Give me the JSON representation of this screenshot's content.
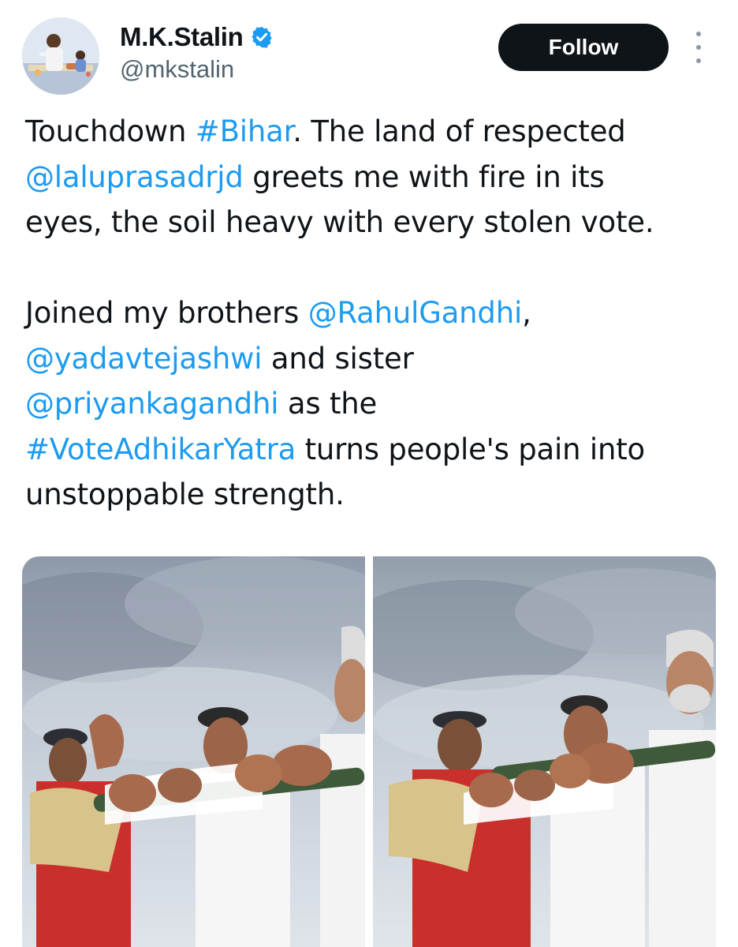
{
  "author": {
    "display_name": "M.K.Stalin",
    "handle": "@mkstalin",
    "verified": true,
    "avatar_icon": "profile-photo"
  },
  "actions": {
    "follow_label": "Follow",
    "more_icon": "more-vertical-icon"
  },
  "tweet": {
    "lines": [
      [
        {
          "t": "Touchdown ",
          "link": false
        },
        {
          "t": "#Bihar",
          "link": true
        },
        {
          "t": ". The land of respected",
          "link": false
        }
      ],
      [
        {
          "t": "@laluprasadrjd",
          "link": true
        },
        {
          "t": " greets me with fire in its",
          "link": false
        }
      ],
      [
        {
          "t": "eyes, the soil heavy with every stolen vote.",
          "link": false
        }
      ],
      [],
      [
        {
          "t": "Joined my brothers ",
          "link": false
        },
        {
          "t": "@RahulGandhi",
          "link": true
        },
        {
          "t": ",",
          "link": false
        }
      ],
      [
        {
          "t": "@yadavtejashwi",
          "link": true
        },
        {
          "t": " and sister",
          "link": false
        }
      ],
      [
        {
          "t": "@priyankagandhi",
          "link": true
        },
        {
          "t": " as the",
          "link": false
        }
      ],
      [
        {
          "t": "#VoteAdhikarYatra",
          "link": true
        },
        {
          "t": " turns people's pain into",
          "link": false
        }
      ],
      [
        {
          "t": "unstoppable strength.",
          "link": false
        }
      ]
    ]
  },
  "media": {
    "photos": [
      {
        "name": "photo-left"
      },
      {
        "name": "photo-right"
      }
    ]
  },
  "colors": {
    "link": "#1d9bf0",
    "text": "#0f1419",
    "secondary": "#536471",
    "follow_bg": "#0f1419",
    "verified": "#1d9bf0"
  }
}
